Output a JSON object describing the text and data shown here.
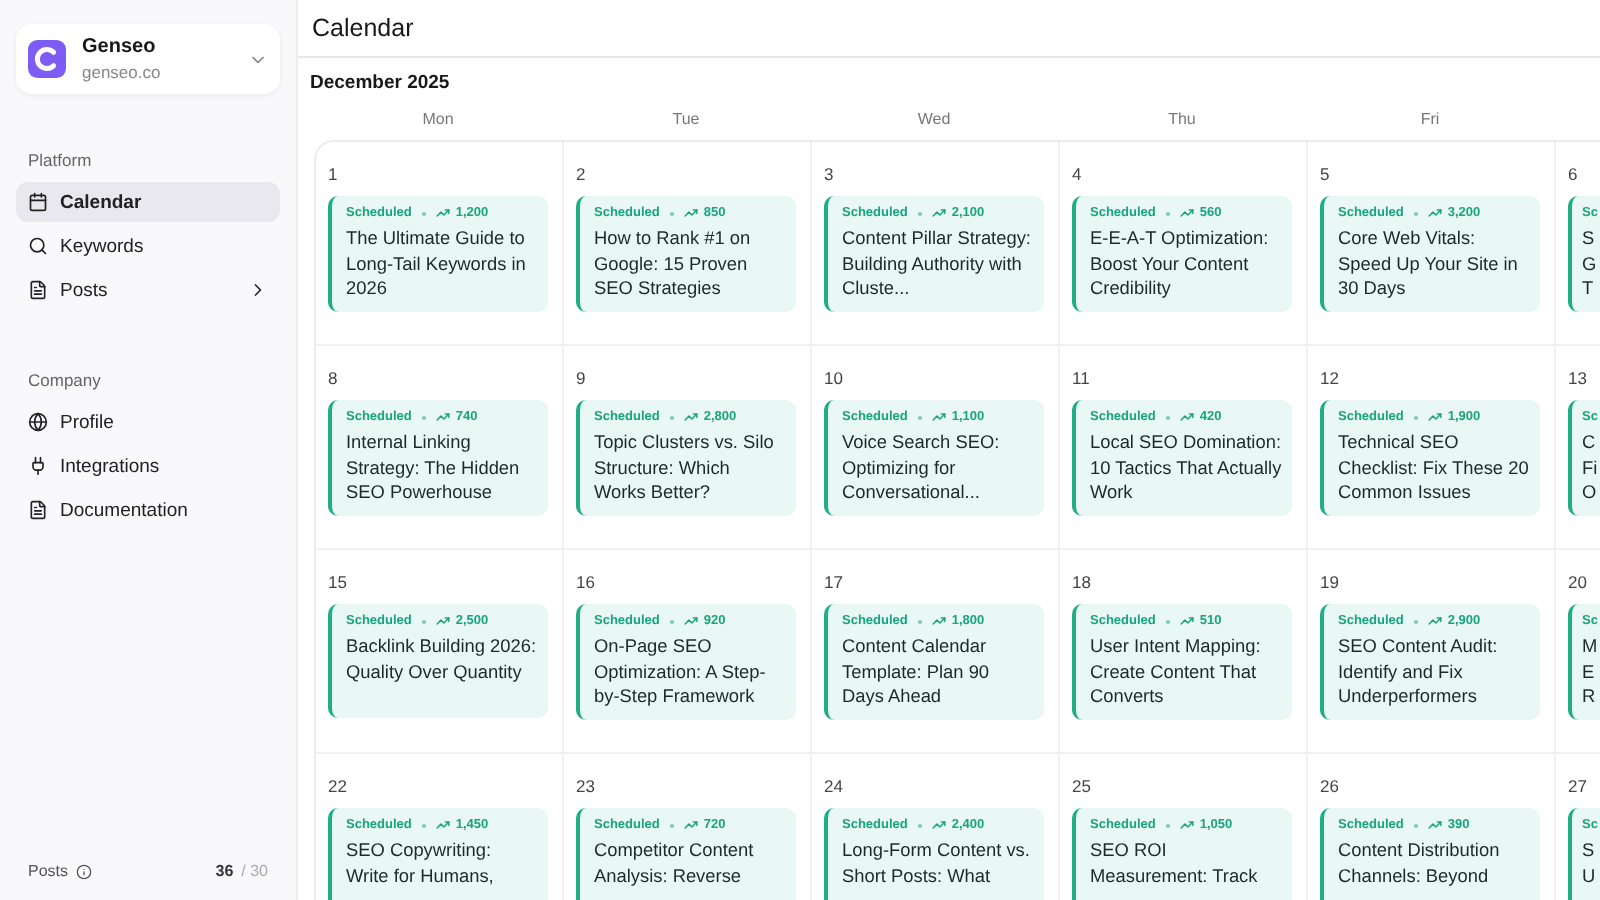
{
  "workspace": {
    "name": "Genseo",
    "domain": "genseo.co"
  },
  "sidebar": {
    "sections": [
      {
        "title": "Platform",
        "items": [
          {
            "label": "Calendar",
            "selected": true,
            "has_submenu": false
          },
          {
            "label": "Keywords",
            "selected": false,
            "has_submenu": false
          },
          {
            "label": "Posts",
            "selected": false,
            "has_submenu": true
          }
        ]
      },
      {
        "title": "Company",
        "items": [
          {
            "label": "Profile",
            "selected": false,
            "has_submenu": false
          },
          {
            "label": "Integrations",
            "selected": false,
            "has_submenu": false
          },
          {
            "label": "Documentation",
            "selected": false,
            "has_submenu": false
          }
        ]
      }
    ],
    "usage": [
      {
        "label": "Posts",
        "used": "36",
        "limit": "/ 30"
      }
    ]
  },
  "page_title": "Calendar",
  "month": "December 2025",
  "weekdays": [
    "Mon",
    "Tue",
    "Wed",
    "Thu",
    "Fri"
  ],
  "weeks": [
    {
      "days": [
        {
          "day": "1",
          "posts": [
            {
              "status": "Scheduled",
              "volume": "1,200",
              "title": "The Ultimate Guide to Long-Tail Keywords in 2026"
            }
          ]
        },
        {
          "day": "2",
          "posts": [
            {
              "status": "Scheduled",
              "volume": "850",
              "title": "How to Rank #1 on Google: 15 Proven SEO Strategies"
            }
          ]
        },
        {
          "day": "3",
          "posts": [
            {
              "status": "Scheduled",
              "volume": "2,100",
              "title": "Content Pillar Strategy: Building Authority with Cluste..."
            }
          ]
        },
        {
          "day": "4",
          "posts": [
            {
              "status": "Scheduled",
              "volume": "560",
              "title": "E-E-A-T Optimization: Boost Your Content Credibility"
            }
          ]
        },
        {
          "day": "5",
          "posts": [
            {
              "status": "Scheduled",
              "volume": "3,200",
              "title": "Core Web Vitals: Speed Up Your Site in 30 Days"
            }
          ]
        }
      ],
      "cut_day": {
        "day": "6",
        "status": "Sc",
        "lines": [
          "S",
          "G",
          "T"
        ]
      }
    },
    {
      "days": [
        {
          "day": "8",
          "posts": [
            {
              "status": "Scheduled",
              "volume": "740",
              "title": "Internal Linking Strategy: The Hidden SEO Powerhouse"
            }
          ]
        },
        {
          "day": "9",
          "posts": [
            {
              "status": "Scheduled",
              "volume": "2,800",
              "title": "Topic Clusters vs. Silo Structure: Which Works Better?"
            }
          ]
        },
        {
          "day": "10",
          "posts": [
            {
              "status": "Scheduled",
              "volume": "1,100",
              "title": "Voice Search SEO: Optimizing for Conversational..."
            }
          ]
        },
        {
          "day": "11",
          "posts": [
            {
              "status": "Scheduled",
              "volume": "420",
              "title": "Local SEO Domination: 10 Tactics That Actually Work"
            }
          ]
        },
        {
          "day": "12",
          "posts": [
            {
              "status": "Scheduled",
              "volume": "1,900",
              "title": "Technical SEO Checklist: Fix These 20 Common Issues"
            }
          ]
        }
      ],
      "cut_day": {
        "day": "13",
        "status": "Sc",
        "lines": [
          "C",
          "Fi",
          "O"
        ]
      }
    },
    {
      "days": [
        {
          "day": "15",
          "posts": [
            {
              "status": "Scheduled",
              "volume": "2,500",
              "title": "Backlink Building 2026: Quality Over Quantity"
            }
          ]
        },
        {
          "day": "16",
          "posts": [
            {
              "status": "Scheduled",
              "volume": "920",
              "title": "On-Page SEO Optimization: A Step-by-Step Framework"
            }
          ]
        },
        {
          "day": "17",
          "posts": [
            {
              "status": "Scheduled",
              "volume": "1,800",
              "title": "Content Calendar Template: Plan 90 Days Ahead"
            }
          ]
        },
        {
          "day": "18",
          "posts": [
            {
              "status": "Scheduled",
              "volume": "510",
              "title": "User Intent Mapping: Create Content That Converts"
            }
          ]
        },
        {
          "day": "19",
          "posts": [
            {
              "status": "Scheduled",
              "volume": "2,900",
              "title": "SEO Content Audit: Identify and Fix Underperformers"
            }
          ]
        }
      ],
      "cut_day": {
        "day": "20",
        "status": "Sc",
        "lines": [
          "M",
          "E",
          "R"
        ]
      }
    },
    {
      "days": [
        {
          "day": "22",
          "posts": [
            {
              "status": "Scheduled",
              "volume": "1,450",
              "title": "SEO Copywriting: Write for Humans,"
            }
          ]
        },
        {
          "day": "23",
          "posts": [
            {
              "status": "Scheduled",
              "volume": "720",
              "title": "Competitor Content Analysis: Reverse"
            }
          ]
        },
        {
          "day": "24",
          "posts": [
            {
              "status": "Scheduled",
              "volume": "2,400",
              "title": "Long-Form Content vs. Short Posts: What"
            }
          ]
        },
        {
          "day": "25",
          "posts": [
            {
              "status": "Scheduled",
              "volume": "1,050",
              "title": "SEO ROI Measurement: Track"
            }
          ]
        },
        {
          "day": "26",
          "posts": [
            {
              "status": "Scheduled",
              "volume": "390",
              "title": "Content Distribution Channels: Beyond"
            }
          ]
        }
      ],
      "cut_day": {
        "day": "27",
        "status": "Sc",
        "lines": [
          "S",
          "U"
        ]
      }
    }
  ]
}
